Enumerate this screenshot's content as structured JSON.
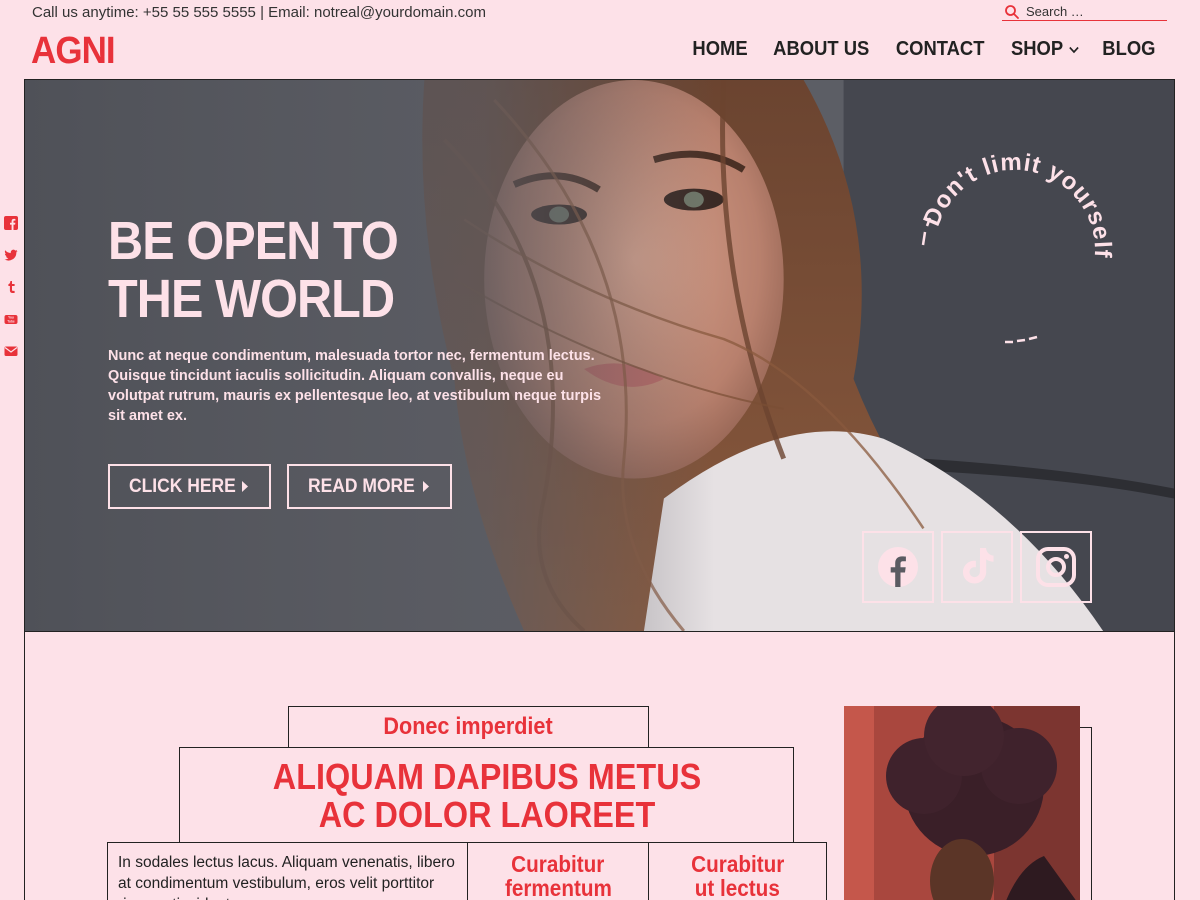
{
  "topbar": {
    "contact": "Call us anytime: +55 55 555 5555 | Email: notreal@yourdomain.com",
    "search_placeholder": "Search …"
  },
  "header": {
    "logo": "AGNI",
    "nav": [
      {
        "label": "HOME"
      },
      {
        "label": "ABOUT US"
      },
      {
        "label": "CONTACT"
      },
      {
        "label": "SHOP",
        "has_dropdown": true
      },
      {
        "label": "BLOG"
      }
    ]
  },
  "side_social": [
    "facebook-icon",
    "twitter-icon",
    "tumblr-icon",
    "youtube-icon",
    "email-icon"
  ],
  "hero": {
    "title_line1": "BE OPEN TO",
    "title_line2": "THE WORLD",
    "text": "Nunc at neque condimentum, malesuada tortor nec, fermentum lectus. Quisque tincidunt iaculis sollicitudin. Aliquam convallis, neque eu volutpat rutrum, mauris ex pellentesque leo, at vestibulum neque turpis sit amet ex.",
    "button1": "CLICK HERE",
    "button2": "READ MORE",
    "circle_text": "Don't limit yourself",
    "social": [
      "facebook-icon",
      "tiktok-icon",
      "instagram-icon"
    ]
  },
  "section": {
    "kicker": "Donec imperdiet",
    "headline_line1": "ALIQUAM DAPIBUS METUS",
    "headline_line2": "AC DOLOR LAOREET",
    "body": "In sodales lectus lacus. Aliquam venenatis, libero at condimentum vestibulum, eros velit porttitor risus, a tincidunt neque eros a neque.",
    "col1_title_line1": "Curabitur",
    "col1_title_line2": "fermentum",
    "col2_title_line1": "Curabitur",
    "col2_title_line2": "ut lectus"
  },
  "colors": {
    "accent": "#e8323a",
    "background": "#fde1e8",
    "text": "#222222"
  }
}
